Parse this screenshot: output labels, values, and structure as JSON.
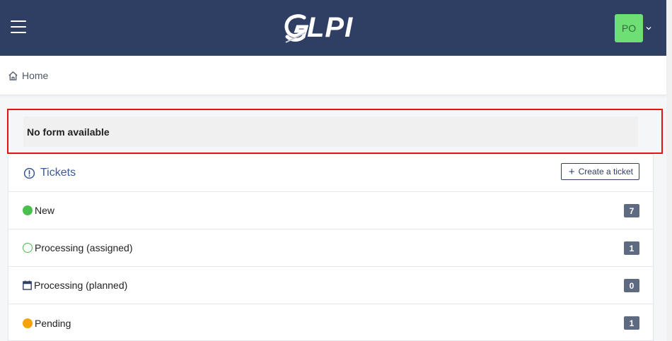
{
  "header": {
    "logo_text": "LPI",
    "user_initials": "PO",
    "colors": {
      "background": "#2f3e63",
      "avatar": "#6ddf75"
    }
  },
  "breadcrumb": {
    "label": "Home",
    "icon": "home-icon"
  },
  "notice": {
    "text": "No form available"
  },
  "tickets": {
    "title": "Tickets",
    "title_icon": "alert-circle-icon",
    "create_label": "Create a ticket",
    "rows": [
      {
        "label": "New",
        "count": "7",
        "icon": "status-new-icon",
        "color": "#49bf4e"
      },
      {
        "label": "Processing (assigned)",
        "count": "1",
        "icon": "status-assigned-icon",
        "color": "#49bf4e"
      },
      {
        "label": "Processing (planned)",
        "count": "0",
        "icon": "calendar-icon",
        "color": "#2f3e63"
      },
      {
        "label": "Pending",
        "count": "1",
        "icon": "status-pending-icon",
        "color": "#f5a30a"
      }
    ]
  }
}
